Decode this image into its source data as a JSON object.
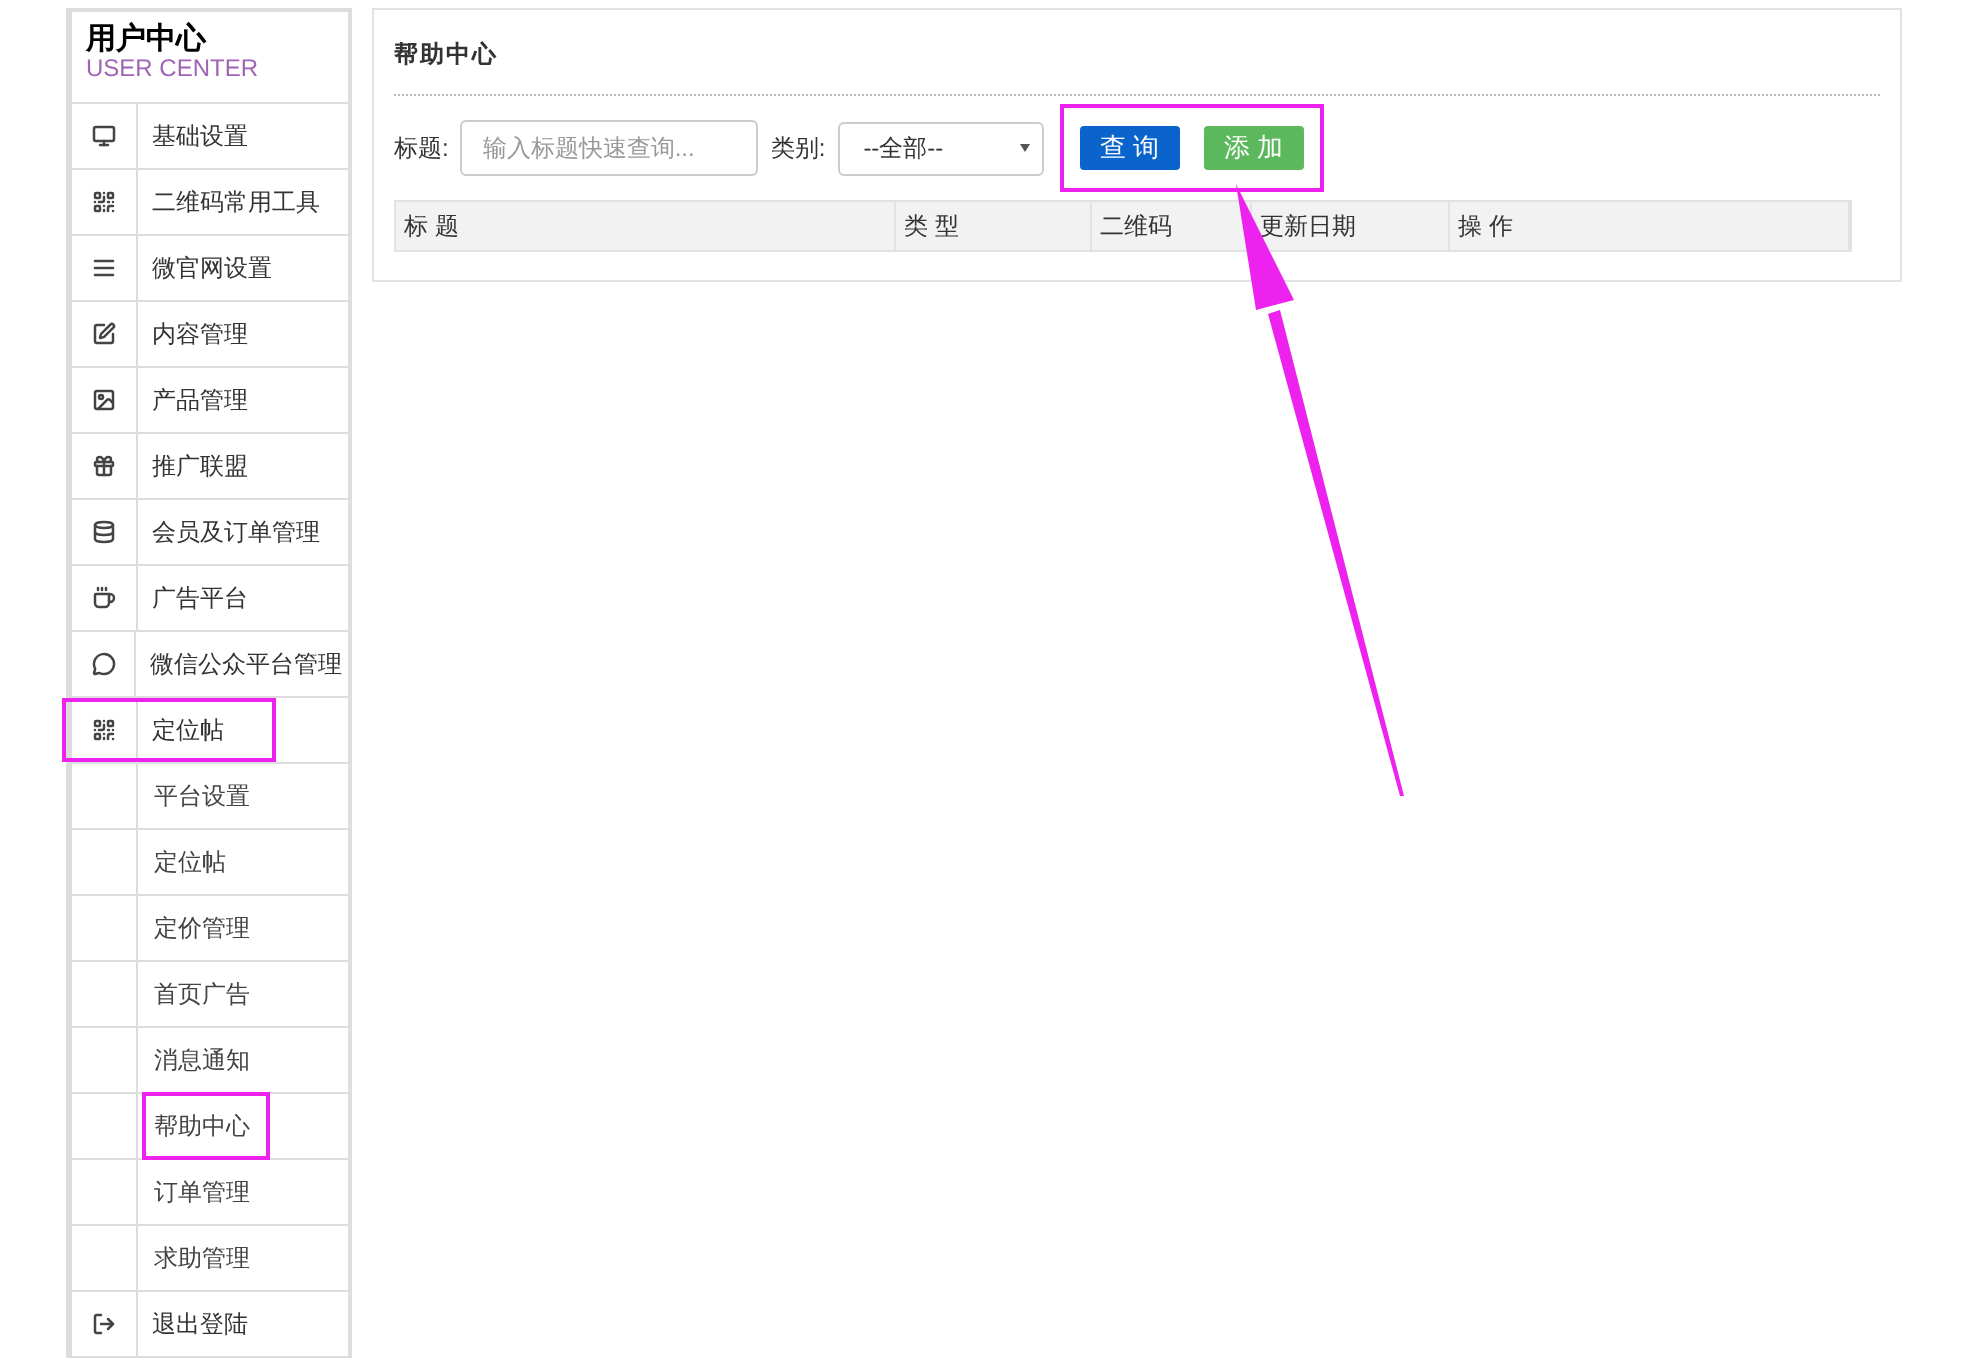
{
  "sidebar": {
    "title": "用户中心",
    "subtitle": "USER CENTER",
    "items": [
      {
        "label": "基础设置",
        "highlighted": false
      },
      {
        "label": "二维码常用工具",
        "highlighted": false
      },
      {
        "label": "微官网设置",
        "highlighted": false
      },
      {
        "label": "内容管理",
        "highlighted": false
      },
      {
        "label": "产品管理",
        "highlighted": false
      },
      {
        "label": "推广联盟",
        "highlighted": false
      },
      {
        "label": "会员及订单管理",
        "highlighted": false
      },
      {
        "label": "广告平台",
        "highlighted": false
      },
      {
        "label": "微信公众平台管理",
        "highlighted": false
      },
      {
        "label": "定位帖",
        "highlighted": true,
        "children": [
          {
            "label": "平台设置",
            "highlighted": false
          },
          {
            "label": "定位帖",
            "highlighted": false
          },
          {
            "label": "定价管理",
            "highlighted": false
          },
          {
            "label": "首页广告",
            "highlighted": false
          },
          {
            "label": "消息通知",
            "highlighted": false
          },
          {
            "label": "帮助中心",
            "highlighted": true
          },
          {
            "label": "订单管理",
            "highlighted": false
          },
          {
            "label": "求助管理",
            "highlighted": false
          }
        ]
      },
      {
        "label": "退出登陆",
        "highlighted": false
      }
    ]
  },
  "panel": {
    "title": "帮助中心",
    "filters": {
      "title_label": "标题:",
      "title_placeholder": "输入标题快速查询...",
      "category_label": "类别:",
      "category_value": "--全部--"
    },
    "buttons": [
      {
        "label": "查 询",
        "kind": "primary"
      },
      {
        "label": "添 加",
        "kind": "success"
      }
    ],
    "buttons_highlighted": true,
    "table": {
      "columns": [
        "标 题",
        "类 型",
        "二维码",
        "更新日期",
        "操 作"
      ]
    }
  },
  "annotation_arrow": true
}
